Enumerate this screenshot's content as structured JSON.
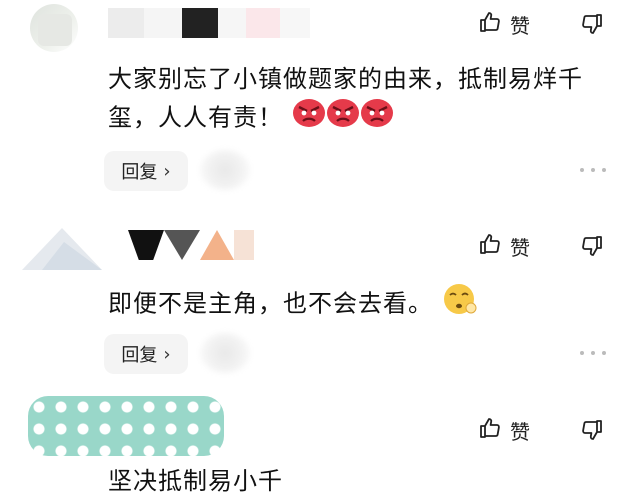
{
  "comments": [
    {
      "like_label": "赞",
      "text": "大家别忘了小镇做题家的由来，抵制易烊千玺，人人有责！",
      "emojis": [
        "angry-face-emoji",
        "angry-face-emoji",
        "angry-face-emoji"
      ],
      "reply_label": "回复",
      "reply_chevron": "›"
    },
    {
      "like_label": "赞",
      "text": "即便不是主角，也不会去看。",
      "emojis": [
        "sleepy-face-emoji"
      ],
      "reply_label": "回复",
      "reply_chevron": "›"
    },
    {
      "like_label": "赞",
      "text_partial": "坚决抵制易小千"
    }
  ],
  "colors": {
    "text": "#111111",
    "reply_bg": "#f4f4f4",
    "more_dots": "#bbbbbb",
    "angry_emoji": "#e53a4a",
    "teal_blur": "#8fd3c4"
  }
}
